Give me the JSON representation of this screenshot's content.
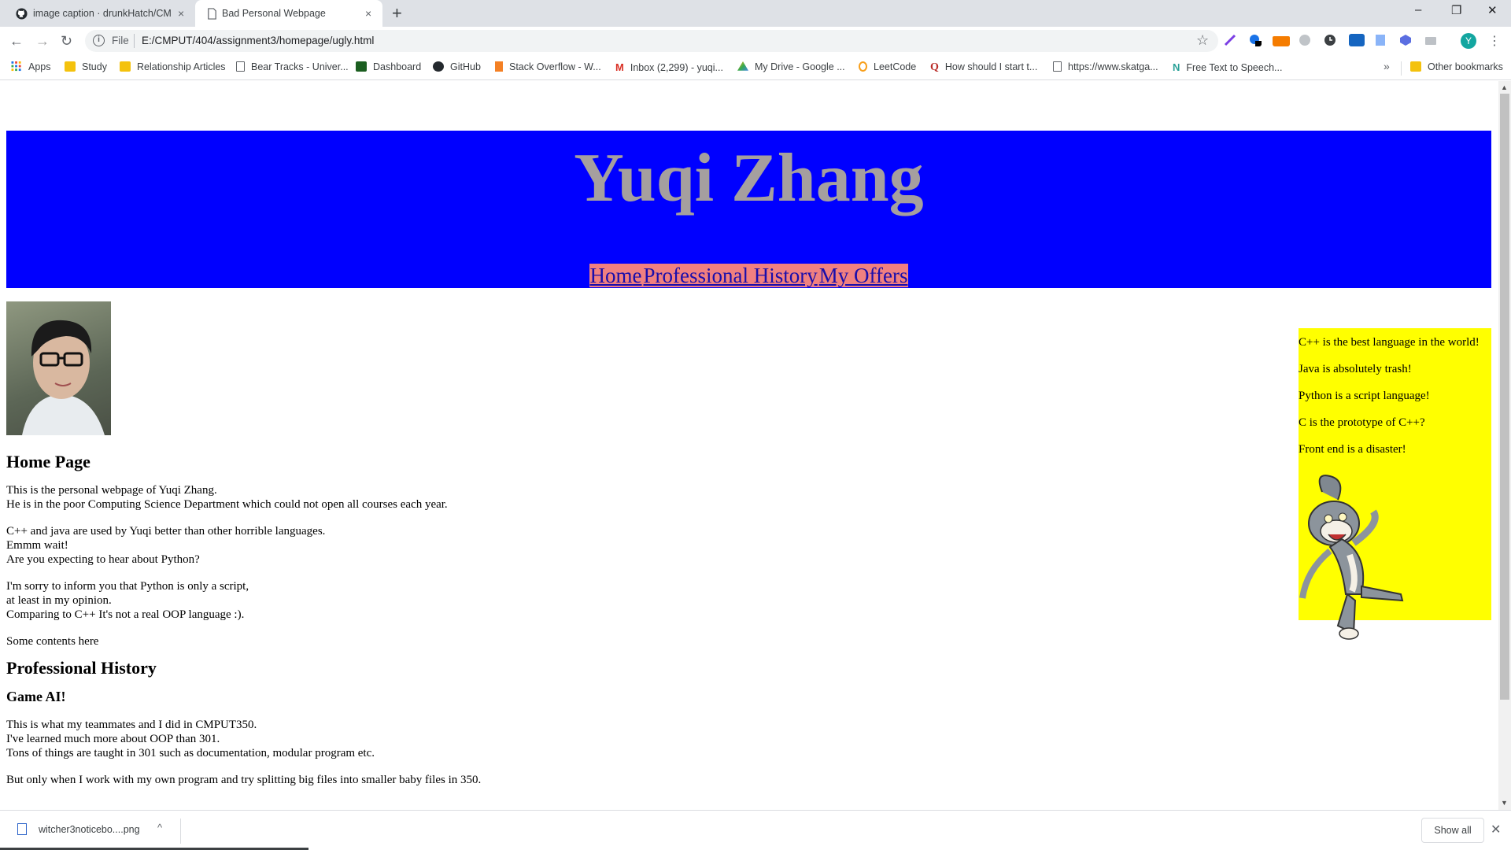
{
  "browser": {
    "tabs": [
      {
        "title": "image caption · drunkHatch/CMP",
        "close": "×",
        "active": false
      },
      {
        "title": "Bad Personal Webpage",
        "close": "×",
        "active": true
      }
    ],
    "new_tab": "+",
    "window_controls": {
      "minimize": "–",
      "maximize": "❐",
      "close": "✕"
    },
    "nav": {
      "back": "←",
      "forward": "→",
      "reload": "↻"
    },
    "address": {
      "scheme": "File",
      "url": "E:/CMPUT/404/assignment3/homepage/ugly.html",
      "star": "☆"
    },
    "profile_initial": "Y",
    "menu": "⋮",
    "bookmarks": [
      {
        "label": "Apps",
        "icon": "apps-grid-icon"
      },
      {
        "label": "Study",
        "icon": "folder-icon"
      },
      {
        "label": "Relationship Articles",
        "icon": "folder-icon"
      },
      {
        "label": "Bear Tracks - Univer...",
        "icon": "page-icon"
      },
      {
        "label": "Dashboard",
        "icon": "graduation-cap-icon"
      },
      {
        "label": "GitHub",
        "icon": "github-icon"
      },
      {
        "label": "Stack Overflow - W...",
        "icon": "stackoverflow-icon"
      },
      {
        "label": "Inbox (2,299) - yuqi...",
        "icon": "gmail-icon"
      },
      {
        "label": "My Drive - Google ...",
        "icon": "drive-icon"
      },
      {
        "label": "LeetCode",
        "icon": "leetcode-icon"
      },
      {
        "label": "How should I start t...",
        "icon": "quora-icon"
      },
      {
        "label": "https://www.skatga...",
        "icon": "page-icon"
      },
      {
        "label": "Free Text to Speech...",
        "icon": "speech-icon"
      }
    ],
    "bookmarks_more": "»",
    "other_bookmarks": "Other bookmarks",
    "colors": {
      "tabstrip": "#dee1e6",
      "omnibox": "#f1f3f4"
    }
  },
  "page": {
    "title": "Yuqi Zhang",
    "nav": [
      "Home",
      "Professional History",
      "My Offers"
    ],
    "home": {
      "heading": "Home Page",
      "paragraphs": [
        [
          "This is the personal webpage of Yuqi Zhang.",
          "He is in the poor Computing Science Department which could not open all courses each year."
        ],
        [
          "C++ and java are used by Yuqi better than other horrible languages.",
          "Emmm wait!",
          "Are you expecting to hear about Python?"
        ],
        [
          "I'm sorry to inform you that Python is only a script,",
          "at least in my opinion.",
          "Comparing to C++ It's not a real OOP language :)."
        ],
        [
          "Some contents here"
        ]
      ]
    },
    "history": {
      "heading": "Professional History",
      "subheading": "Game AI!",
      "paragraphs": [
        [
          "This is what my teammates and I did in CMPUT350.",
          "I've learned much more about OOP than 301.",
          "Tons of things are taught in 301 such as documentation, modular program etc."
        ],
        [
          "But only when I work with my own program and try splitting big files into smaller baby files in 350."
        ]
      ]
    },
    "sidebar": [
      "C++ is the best language in the world!",
      "Java is absolutely trash!",
      "Python is a script language!",
      "C is the prototype of C++?",
      "Front end is a disaster!"
    ],
    "colors": {
      "header_bg": "#0000ff",
      "title": "#a59f9f",
      "nav_bg": "#f08080",
      "sidebar_bg": "#ffff00"
    }
  },
  "downloads": {
    "file": "witcher3noticebo....png",
    "caret": "^",
    "show_all": "Show all",
    "close": "✕"
  }
}
